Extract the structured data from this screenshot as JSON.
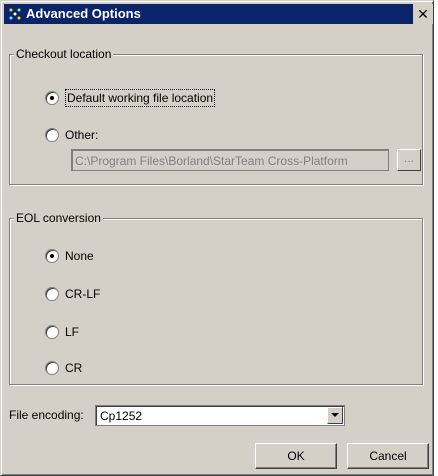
{
  "window": {
    "title": "Advanced Options",
    "close_glyph": "✕"
  },
  "checkout": {
    "legend": "Checkout location",
    "default_label": "Default working file location",
    "other_label": "Other:",
    "path_value": "C:\\Program Files\\Borland\\StarTeam Cross-Platform",
    "browse_label": "...",
    "selected": "default"
  },
  "eol": {
    "legend": "EOL conversion",
    "options": [
      "None",
      "CR-LF",
      "LF",
      "CR"
    ],
    "selected": "None"
  },
  "encoding": {
    "label": "File encoding:",
    "value": "Cp1252"
  },
  "buttons": {
    "ok": "OK",
    "cancel": "Cancel"
  },
  "icons": {
    "app": "starteam-app-icon",
    "close": "close-icon",
    "dropdown": "chevron-down-icon"
  }
}
